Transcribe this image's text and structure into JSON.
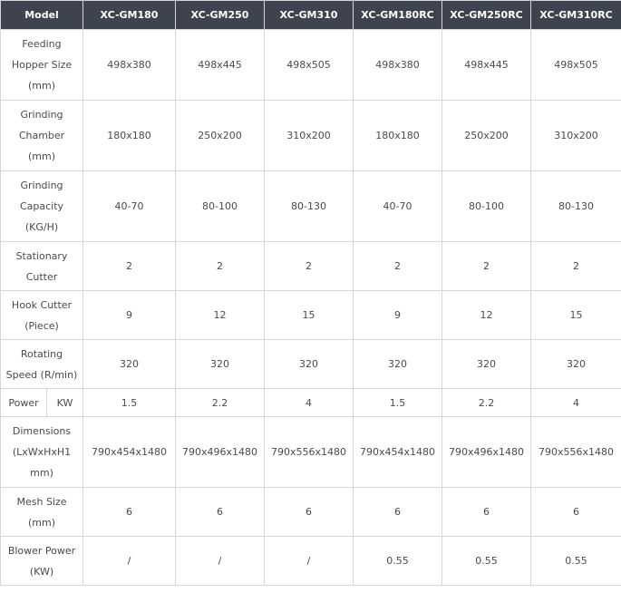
{
  "header": {
    "model": "Model",
    "columns": [
      "XC-GM180",
      "XC-GM250",
      "XC-GM310",
      "XC-GM180RC",
      "XC-GM250RC",
      "XC-GM310RC"
    ]
  },
  "rows": [
    {
      "label": "Feeding Hopper Size (mm)",
      "values": [
        "498x380",
        "498x445",
        "498x505",
        "498x380",
        "498x445",
        "498x505"
      ]
    },
    {
      "label": "Grinding Chamber (mm)",
      "values": [
        "180x180",
        "250x200",
        "310x200",
        "180x180",
        "250x200",
        "310x200"
      ]
    },
    {
      "label": "Grinding Capacity (KG/H)",
      "values": [
        "40-70",
        "80-100",
        "80-130",
        "40-70",
        "80-100",
        "80-130"
      ]
    },
    {
      "label": "Stationary Cutter",
      "values": [
        "2",
        "2",
        "2",
        "2",
        "2",
        "2"
      ]
    },
    {
      "label": "Hook Cutter (Piece)",
      "values": [
        "9",
        "12",
        "15",
        "9",
        "12",
        "15"
      ]
    },
    {
      "label": "Rotating Speed (R/min)",
      "values": [
        "320",
        "320",
        "320",
        "320",
        "320",
        "320"
      ]
    },
    {
      "label": "Power",
      "unit": "KW",
      "values": [
        "1.5",
        "2.2",
        "4",
        "1.5",
        "2.2",
        "4"
      ]
    },
    {
      "label": "Dimensions (LxWxHxH1 mm)",
      "values": [
        "790x454x1480",
        "790x496x1480",
        "790x556x1480",
        "790x454x1480",
        "790x496x1480",
        "790x556x1480"
      ]
    },
    {
      "label": "Mesh Size (mm)",
      "values": [
        "6",
        "6",
        "6",
        "6",
        "6",
        "6"
      ]
    },
    {
      "label": "Blower Power (KW)",
      "values": [
        "/",
        "/",
        "/",
        "0.55",
        "0.55",
        "0.55"
      ]
    }
  ]
}
